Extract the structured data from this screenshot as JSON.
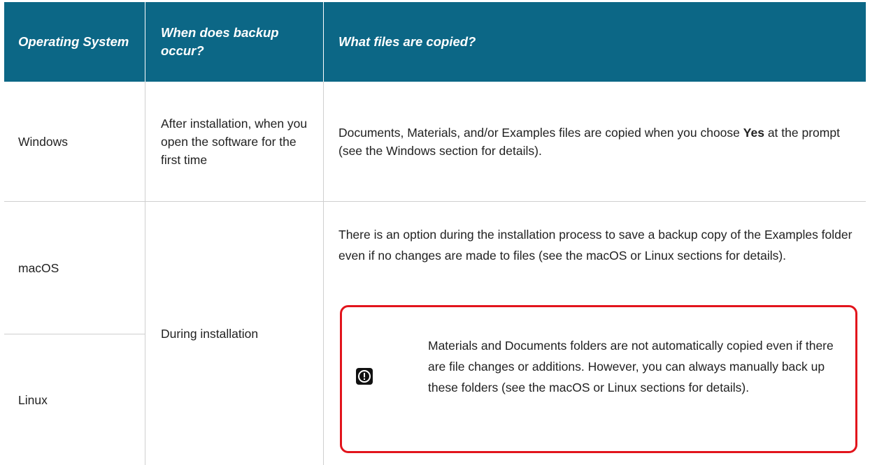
{
  "table": {
    "headers": [
      "Operating System",
      "When does backup occur?",
      "What files are copied?"
    ],
    "rows": [
      {
        "os": "Windows",
        "when": "After installation, when you open the software for the first time",
        "files_pre": "Documents, Materials, and/or Examples files are copied when you choose ",
        "files_bold": "Yes",
        "files_post": " at the prompt (see the Windows section for details)."
      },
      {
        "os": "macOS"
      },
      {
        "os": "Linux"
      }
    ],
    "shared_when": "During installation",
    "shared_files": "There is an option during the installation process to save a backup copy of the Examples folder even if no changes are made to files (see the macOS or Linux sections for details)."
  },
  "note": {
    "icon": "exclamation-icon",
    "accent_color": "#e2141c",
    "text": "Materials and Documents folders are not automatically copied even if there are file changes or additions. However, you can always manually back up these folders (see the macOS or Linux sections for details)."
  },
  "colors": {
    "header_bg": "#0c6786",
    "header_text": "#ffffff",
    "grid": "#cfcfcf"
  }
}
